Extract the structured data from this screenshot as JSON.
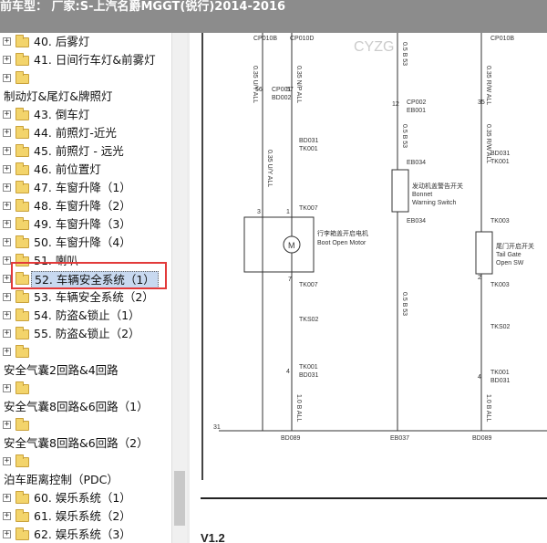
{
  "window": {
    "title": "前车型： 厂家:S-上汽名爵MGGT(锐行)2014-2016"
  },
  "tree": {
    "items": [
      {
        "label": "40. 后雾灯",
        "level": 1
      },
      {
        "label": "41. 日间行车灯&前雾灯",
        "level": 1
      },
      {
        "label": "",
        "level": 1
      },
      {
        "label": "制动灯&尾灯&牌照灯",
        "level": 0
      },
      {
        "label": "43. 倒车灯",
        "level": 1
      },
      {
        "label": "44. 前照灯-近光",
        "level": 1
      },
      {
        "label": "45. 前照灯 - 远光",
        "level": 1
      },
      {
        "label": "46. 前位置灯",
        "level": 1
      },
      {
        "label": "47. 车窗升降（1）",
        "level": 1
      },
      {
        "label": "48. 车窗升降（2）",
        "level": 1
      },
      {
        "label": "49. 车窗升降（3）",
        "level": 1
      },
      {
        "label": "50. 车窗升降（4）",
        "level": 1
      },
      {
        "label": "51. 喇叭",
        "level": 1
      },
      {
        "label": "52. 车辆安全系统（1）",
        "level": 1,
        "selected": true
      },
      {
        "label": "53. 车辆安全系统（2）",
        "level": 1
      },
      {
        "label": "54. 防盗&锁止（1）",
        "level": 1
      },
      {
        "label": "55. 防盗&锁止（2）",
        "level": 1
      },
      {
        "label": "",
        "level": 1
      },
      {
        "label": "安全气囊2回路&4回路",
        "level": 0
      },
      {
        "label": "",
        "level": 1
      },
      {
        "label": "安全气囊8回路&6回路（1）",
        "level": 0
      },
      {
        "label": "",
        "level": 1
      },
      {
        "label": "安全气囊8回路&6回路（2）",
        "level": 0
      },
      {
        "label": "",
        "level": 1
      },
      {
        "label": "泊车距离控制（PDC）",
        "level": 0
      },
      {
        "label": "60. 娱乐系统（1）",
        "level": 1
      },
      {
        "label": "61. 娱乐系统（2）",
        "level": 1
      },
      {
        "label": "62. 娱乐系统（3）",
        "level": 1
      },
      {
        "label": "",
        "level": 1
      }
    ]
  },
  "diagram": {
    "labels": {
      "cp010b_1": "CP010B",
      "cp010d": "CP010D",
      "cp010b_2": "CP010B",
      "wire_a1": "0.35 U/Y ALL",
      "wire_b1": "0.35 N/P ALL",
      "wire_c1": "0.5 B 53",
      "wire_d1": "0.35 R/W ALL",
      "cp001": "CP001",
      "bd002": "BD002",
      "cp002": "CP002",
      "eb001": "EB001",
      "bd031_1": "BD031",
      "tk001_1": "TK001",
      "bd031_2": "BD031",
      "tk001_2": "TK001",
      "eb034_1": "EB034",
      "bonnet_cn": "发动机盖警告开关",
      "bonnet_en1": "Bonnet",
      "bonnet_en2": "Warning Switch",
      "eb034_2": "EB034",
      "tk007_1": "TK007",
      "trunk_cn": "行李箱盖开启电机",
      "trunk_en": "Boot Open Motor",
      "tk003_1": "TK003",
      "tail_cn": "尾门开启开关",
      "tail_en1": "Tail Gate",
      "tail_en2": "Open SW",
      "tk003_2": "TK003",
      "tk007_2": "TK007",
      "tks02_1": "TKS02",
      "tks02_2": "TKS02",
      "tk001_3": "TK001",
      "bd031_3": "BD031",
      "tk001_4": "TK001",
      "bd031_4": "BD031",
      "wire_b2": "1.0 B ALL",
      "wire_e": "0.5 B 53",
      "wire_f": "1.0 B ALL",
      "ground_num": "31",
      "bd089_1": "BD089",
      "eb037": "EB037",
      "bd089_2": "BD089",
      "motor_symbol": "M",
      "pin_56": "56",
      "pin_57": "57",
      "pin_12": "12",
      "pin_35": "35",
      "pin_1a": "1",
      "pin_7": "7",
      "pin_3": "3",
      "pin_1b": "1",
      "pin_2": "2",
      "pin_4a": "4",
      "pin_4b": "4",
      "watermark": "CYZG"
    },
    "version": "V1.2"
  },
  "colors": {
    "titlebar_bg": "#8c8c8c",
    "selection_box": "#e23a3a",
    "selected_bg": "#c8d9f0",
    "folder": "#f3d46b"
  }
}
